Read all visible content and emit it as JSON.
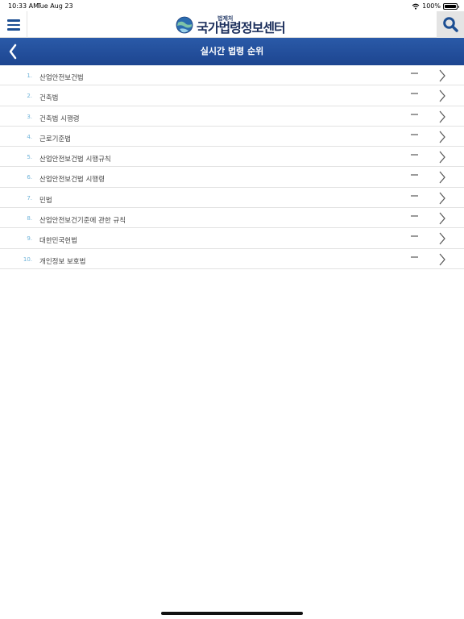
{
  "status": {
    "time": "10:33 AM",
    "date": "Tue Aug 23",
    "battery": "100%"
  },
  "header": {
    "logo_small": "법제처",
    "logo_main": "국가법령정보센터"
  },
  "title_bar": {
    "title": "실시간 법령 순위"
  },
  "rankings": [
    {
      "rank": "1.",
      "name": "산업안전보건법"
    },
    {
      "rank": "2.",
      "name": "건축법"
    },
    {
      "rank": "3.",
      "name": "건축법 시행령"
    },
    {
      "rank": "4.",
      "name": "근로기준법"
    },
    {
      "rank": "5.",
      "name": "산업안전보건법 시행규칙"
    },
    {
      "rank": "6.",
      "name": "산업안전보건법 시행령"
    },
    {
      "rank": "7.",
      "name": "민법"
    },
    {
      "rank": "8.",
      "name": "산업안전보건기준에 관한 규칙"
    },
    {
      "rank": "9.",
      "name": "대한민국헌법"
    },
    {
      "rank": "10.",
      "name": "개인정보 보호법"
    }
  ],
  "colors": {
    "accent": "#1d4f93",
    "title_bar": "#2a5aa8",
    "rank_number": "#6fb3d9"
  },
  "icons": {
    "menu": "hamburger-icon",
    "search": "magnifier-icon",
    "back": "chevron-left-icon",
    "row": "chevron-right-icon",
    "change": "dash-icon"
  }
}
